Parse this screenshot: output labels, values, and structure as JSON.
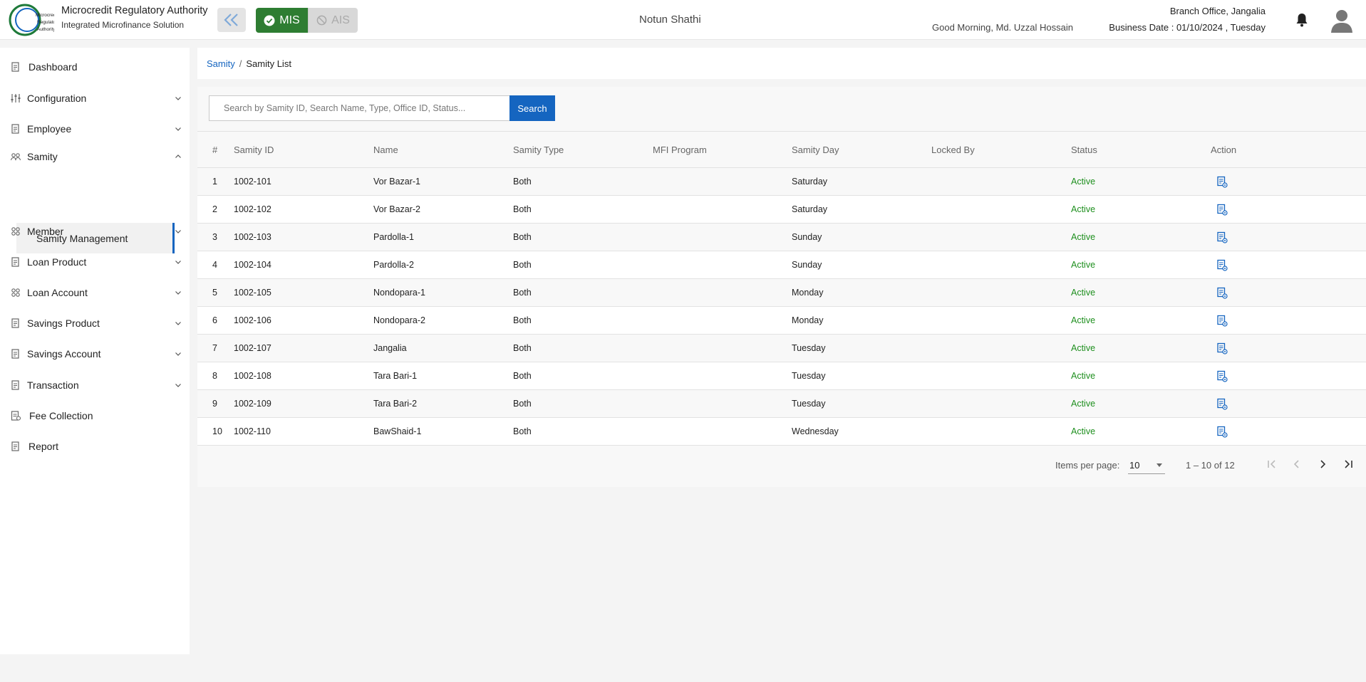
{
  "header": {
    "org_title": "Microcredit Regulatory Authority",
    "org_subtitle": "Integrated Microfinance Solution",
    "logo_text": "Microcredit Regulatory Authority",
    "mode_mis": "MIS",
    "mode_ais": "AIS",
    "app_name": "Notun Shathi",
    "greeting": "Good Morning, Md. Uzzal Hossain",
    "branch": "Branch Office, Jangalia",
    "business_date": "Business Date : 01/10/2024 , Tuesday"
  },
  "sidebar": {
    "items": [
      {
        "label": "Dashboard",
        "icon": "document-icon",
        "expandable": false
      },
      {
        "label": "Configuration",
        "icon": "sliders-icon",
        "expandable": true
      },
      {
        "label": "Employee",
        "icon": "document-icon",
        "expandable": true
      },
      {
        "label": "Samity",
        "icon": "group-icon",
        "expandable": true,
        "expanded": true
      },
      {
        "label": "Member",
        "icon": "members-icon",
        "expandable": true
      },
      {
        "label": "Loan Product",
        "icon": "document-icon",
        "expandable": true
      },
      {
        "label": "Loan Account",
        "icon": "members-icon",
        "expandable": true
      },
      {
        "label": "Savings Product",
        "icon": "document-icon",
        "expandable": true
      },
      {
        "label": "Savings Account",
        "icon": "document-icon",
        "expandable": true
      },
      {
        "label": "Transaction",
        "icon": "document-icon",
        "expandable": true
      },
      {
        "label": "Fee Collection",
        "icon": "receipt-icon",
        "expandable": false
      },
      {
        "label": "Report",
        "icon": "document-icon",
        "expandable": false
      }
    ],
    "active_sub": "Samity Management"
  },
  "breadcrumb": {
    "parent": "Samity",
    "separator": "/",
    "current": "Samity List"
  },
  "search": {
    "placeholder": "Search by Samity ID, Search Name, Type, Office ID, Status...",
    "value": "",
    "button": "Search"
  },
  "table": {
    "columns": [
      "#",
      "Samity ID",
      "Name",
      "Samity Type",
      "MFI Program",
      "Samity Day",
      "Locked By",
      "Status",
      "Action"
    ],
    "rows": [
      [
        "1",
        "1002-101",
        "Vor Bazar-1",
        "Both",
        "",
        "Saturday",
        "",
        "Active"
      ],
      [
        "2",
        "1002-102",
        "Vor Bazar-2",
        "Both",
        "",
        "Saturday",
        "",
        "Active"
      ],
      [
        "3",
        "1002-103",
        "Pardolla-1",
        "Both",
        "",
        "Sunday",
        "",
        "Active"
      ],
      [
        "4",
        "1002-104",
        "Pardolla-2",
        "Both",
        "",
        "Sunday",
        "",
        "Active"
      ],
      [
        "5",
        "1002-105",
        "Nondopara-1",
        "Both",
        "",
        "Monday",
        "",
        "Active"
      ],
      [
        "6",
        "1002-106",
        "Nondopara-2",
        "Both",
        "",
        "Monday",
        "",
        "Active"
      ],
      [
        "7",
        "1002-107",
        "Jangalia",
        "Both",
        "",
        "Tuesday",
        "",
        "Active"
      ],
      [
        "8",
        "1002-108",
        "Tara Bari-1",
        "Both",
        "",
        "Tuesday",
        "",
        "Active"
      ],
      [
        "9",
        "1002-109",
        "Tara Bari-2",
        "Both",
        "",
        "Tuesday",
        "",
        "Active"
      ],
      [
        "10",
        "1002-110",
        "BawShaid-1",
        "Both",
        "",
        "Wednesday",
        "",
        "Active"
      ]
    ]
  },
  "pagination": {
    "items_per_page_label": "Items per page:",
    "items_per_page": "10",
    "range": "1 – 10 of 12"
  },
  "colors": {
    "primary": "#1565c0",
    "mis_green": "#2e7d32",
    "status_active": "#1e8f1e"
  }
}
